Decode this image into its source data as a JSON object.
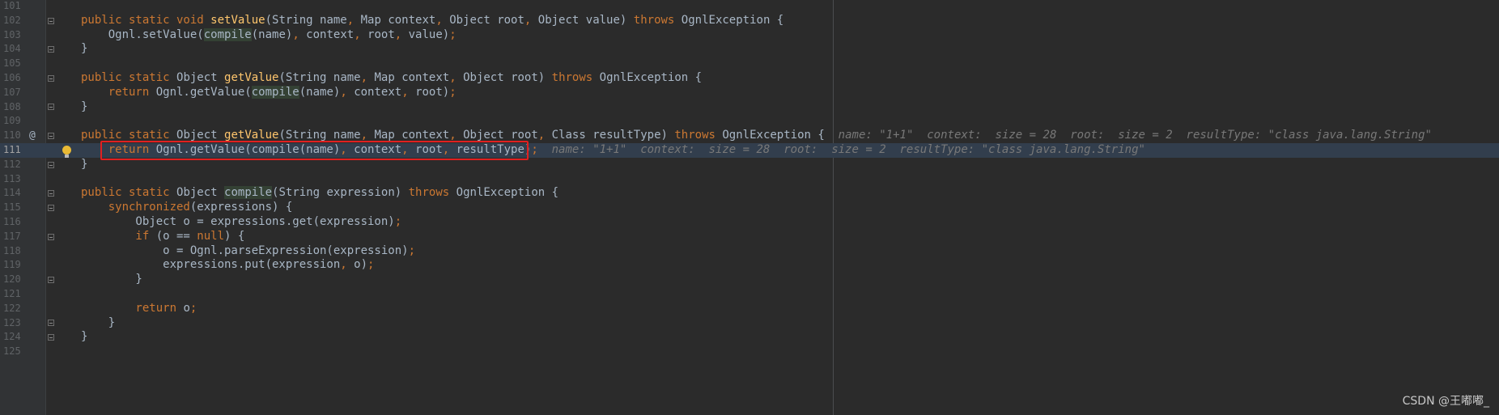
{
  "editor": {
    "lines": [
      {
        "no": "101",
        "segments": []
      },
      {
        "no": "102",
        "segments": [
          {
            "t": "public static void ",
            "c": "kw"
          },
          {
            "t": "setValue",
            "c": "fn"
          },
          {
            "t": "(String name",
            "c": "plain"
          },
          {
            "t": ", ",
            "c": "punc"
          },
          {
            "t": "Map context",
            "c": "plain"
          },
          {
            "t": ", ",
            "c": "punc"
          },
          {
            "t": "Object root",
            "c": "plain"
          },
          {
            "t": ", ",
            "c": "punc"
          },
          {
            "t": "Object value) ",
            "c": "plain"
          },
          {
            "t": "throws ",
            "c": "kw"
          },
          {
            "t": "OgnlException {",
            "c": "plain"
          }
        ]
      },
      {
        "no": "103",
        "segments": [
          {
            "t": "    Ognl.setValue(",
            "c": "plain"
          },
          {
            "t": "compile",
            "c": "fnhl"
          },
          {
            "t": "(name)",
            "c": "plain"
          },
          {
            "t": ", ",
            "c": "punc"
          },
          {
            "t": "context",
            "c": "plain"
          },
          {
            "t": ", ",
            "c": "punc"
          },
          {
            "t": "root",
            "c": "plain"
          },
          {
            "t": ", ",
            "c": "punc"
          },
          {
            "t": "value)",
            "c": "plain"
          },
          {
            "t": ";",
            "c": "punc"
          }
        ]
      },
      {
        "no": "104",
        "segments": [
          {
            "t": "}",
            "c": "plain"
          }
        ]
      },
      {
        "no": "105",
        "segments": []
      },
      {
        "no": "106",
        "segments": [
          {
            "t": "public static ",
            "c": "kw"
          },
          {
            "t": "Object ",
            "c": "plain"
          },
          {
            "t": "getValue",
            "c": "fn"
          },
          {
            "t": "(String name",
            "c": "plain"
          },
          {
            "t": ", ",
            "c": "punc"
          },
          {
            "t": "Map context",
            "c": "plain"
          },
          {
            "t": ", ",
            "c": "punc"
          },
          {
            "t": "Object root) ",
            "c": "plain"
          },
          {
            "t": "throws ",
            "c": "kw"
          },
          {
            "t": "OgnlException {",
            "c": "plain"
          }
        ]
      },
      {
        "no": "107",
        "segments": [
          {
            "t": "    return ",
            "c": "kw"
          },
          {
            "t": "Ognl.getValue(",
            "c": "plain"
          },
          {
            "t": "compile",
            "c": "fnhl"
          },
          {
            "t": "(name)",
            "c": "plain"
          },
          {
            "t": ", ",
            "c": "punc"
          },
          {
            "t": "context",
            "c": "plain"
          },
          {
            "t": ", ",
            "c": "punc"
          },
          {
            "t": "root)",
            "c": "plain"
          },
          {
            "t": ";",
            "c": "punc"
          }
        ]
      },
      {
        "no": "108",
        "segments": [
          {
            "t": "}",
            "c": "plain"
          }
        ]
      },
      {
        "no": "109",
        "segments": []
      },
      {
        "no": "110",
        "marker": "@",
        "segments": [
          {
            "t": "public static ",
            "c": "kw"
          },
          {
            "t": "Object ",
            "c": "plain"
          },
          {
            "t": "getValue",
            "c": "fn"
          },
          {
            "t": "(String name",
            "c": "plain"
          },
          {
            "t": ", ",
            "c": "punc"
          },
          {
            "t": "Map context",
            "c": "plain"
          },
          {
            "t": ", ",
            "c": "punc"
          },
          {
            "t": "Object root",
            "c": "plain"
          },
          {
            "t": ", ",
            "c": "punc"
          },
          {
            "t": "Class resultType) ",
            "c": "plain"
          },
          {
            "t": "throws ",
            "c": "kw"
          },
          {
            "t": "OgnlException { ",
            "c": "plain"
          },
          {
            "t": " name: \"1+1\"  context:  size = 28  root:  size = 2  resultType: \"class java.lang.String\"",
            "c": "hint"
          }
        ]
      },
      {
        "no": "111",
        "current": true,
        "bulb": true,
        "segments": [
          {
            "t": "    return ",
            "c": "kw"
          },
          {
            "t": "Ognl.getValue(compile(name)",
            "c": "plain"
          },
          {
            "t": ", ",
            "c": "punc"
          },
          {
            "t": "context",
            "c": "plain"
          },
          {
            "t": ", ",
            "c": "punc"
          },
          {
            "t": "root",
            "c": "plain"
          },
          {
            "t": ", ",
            "c": "punc"
          },
          {
            "t": "resultType)",
            "c": "plain"
          },
          {
            "t": ";",
            "c": "punc"
          },
          {
            "t": "  name: \"1+1\"  context:  size = 28  root:  size = 2  resultType: \"class java.lang.String\"",
            "c": "hint"
          }
        ]
      },
      {
        "no": "112",
        "segments": [
          {
            "t": "}",
            "c": "plain"
          }
        ]
      },
      {
        "no": "113",
        "segments": []
      },
      {
        "no": "114",
        "segments": [
          {
            "t": "public static ",
            "c": "kw"
          },
          {
            "t": "Object ",
            "c": "plain"
          },
          {
            "t": "compile",
            "c": "fnhl"
          },
          {
            "t": "(String expression) ",
            "c": "plain"
          },
          {
            "t": "throws ",
            "c": "kw"
          },
          {
            "t": "OgnlException {",
            "c": "plain"
          }
        ]
      },
      {
        "no": "115",
        "segments": [
          {
            "t": "    synchronized",
            "c": "kw"
          },
          {
            "t": "(expressions) {",
            "c": "plain"
          }
        ]
      },
      {
        "no": "116",
        "segments": [
          {
            "t": "        Object o = expressions.get(expression)",
            "c": "plain"
          },
          {
            "t": ";",
            "c": "punc"
          }
        ]
      },
      {
        "no": "117",
        "segments": [
          {
            "t": "        if ",
            "c": "kw"
          },
          {
            "t": "(o == ",
            "c": "plain"
          },
          {
            "t": "null",
            "c": "kw"
          },
          {
            "t": ") {",
            "c": "plain"
          }
        ]
      },
      {
        "no": "118",
        "segments": [
          {
            "t": "            o = Ognl.parseExpression(expression)",
            "c": "plain"
          },
          {
            "t": ";",
            "c": "punc"
          }
        ]
      },
      {
        "no": "119",
        "segments": [
          {
            "t": "            expressions.put(expression",
            "c": "plain"
          },
          {
            "t": ", ",
            "c": "punc"
          },
          {
            "t": "o)",
            "c": "plain"
          },
          {
            "t": ";",
            "c": "punc"
          }
        ]
      },
      {
        "no": "120",
        "segments": [
          {
            "t": "        }",
            "c": "plain"
          }
        ]
      },
      {
        "no": "121",
        "segments": []
      },
      {
        "no": "122",
        "segments": [
          {
            "t": "        return ",
            "c": "kw"
          },
          {
            "t": "o",
            "c": "plain"
          },
          {
            "t": ";",
            "c": "punc"
          }
        ]
      },
      {
        "no": "123",
        "segments": [
          {
            "t": "    }",
            "c": "plain"
          }
        ]
      },
      {
        "no": "124",
        "segments": [
          {
            "t": "}",
            "c": "plain"
          }
        ]
      },
      {
        "no": "125",
        "segments": []
      }
    ],
    "fold_lines": [
      "102",
      "104",
      "106",
      "108",
      "110",
      "112",
      "114",
      "115",
      "117",
      "120",
      "123",
      "124"
    ]
  },
  "watermark": {
    "text": "CSDN @王嘟嘟_"
  }
}
